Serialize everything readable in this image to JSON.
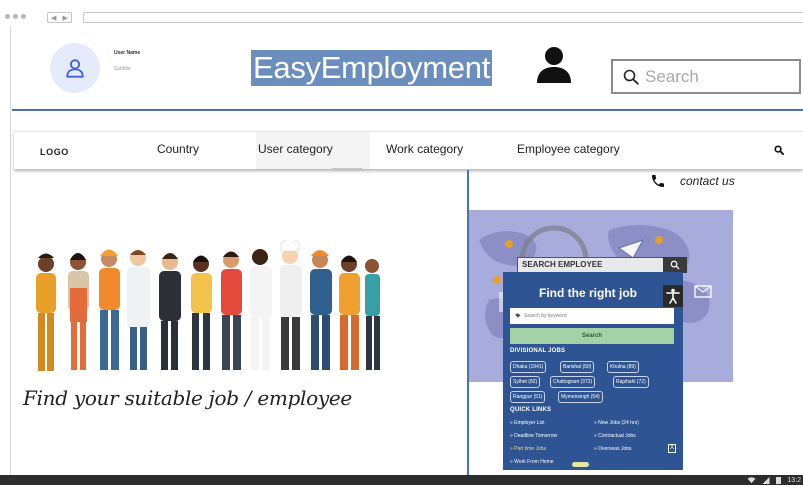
{
  "browser": {
    "nav_back": "◀",
    "nav_forward": "▶"
  },
  "header": {
    "user_name": "User Name",
    "user_subtitle": "Subtitle",
    "brand": "EasyEmployment",
    "search_placeholder": "Search"
  },
  "nav": {
    "logo": "LOGO",
    "items": [
      "Country",
      "User category",
      "Work category",
      "Employee category"
    ],
    "active_item": "User category"
  },
  "contact": {
    "label": "contact us"
  },
  "hero": {
    "tagline": "Find your suitable  job /  employee"
  },
  "promo": {
    "search_employee": "SEARCH EMPLOYEE",
    "title": "Find the right job",
    "keyword_placeholder": "Search by keyword",
    "search_button": "Search",
    "divisional_title": "DIVISIONAL JOBS",
    "divisions": [
      "Dhaka (1941)",
      "Barishal (50)",
      "Khulna (89)",
      "Sylhet (82)",
      "Chattogram (372)",
      "Rajshahi (72)",
      "Rangpur (51)",
      "Mymensingh (54)"
    ],
    "quick_links_title": "QUICK LINKS",
    "quick_links": [
      "» Employer List",
      "» New Jobs (24 hrs)",
      "» Deadline Tomorrow",
      "» Contractual Jobs",
      "» Part time Jobs",
      "» Overseas Jobs",
      "» Work From Home"
    ],
    "ad_close": "X"
  },
  "taskbar": {
    "clock": "13:2"
  },
  "colors": {
    "brand_bg": "#6c8ebf",
    "accent_blue": "#4a74a8",
    "panel_blue": "#2e5493",
    "promo_bg": "#a8acdc",
    "search_button": "#a3d2a8"
  }
}
